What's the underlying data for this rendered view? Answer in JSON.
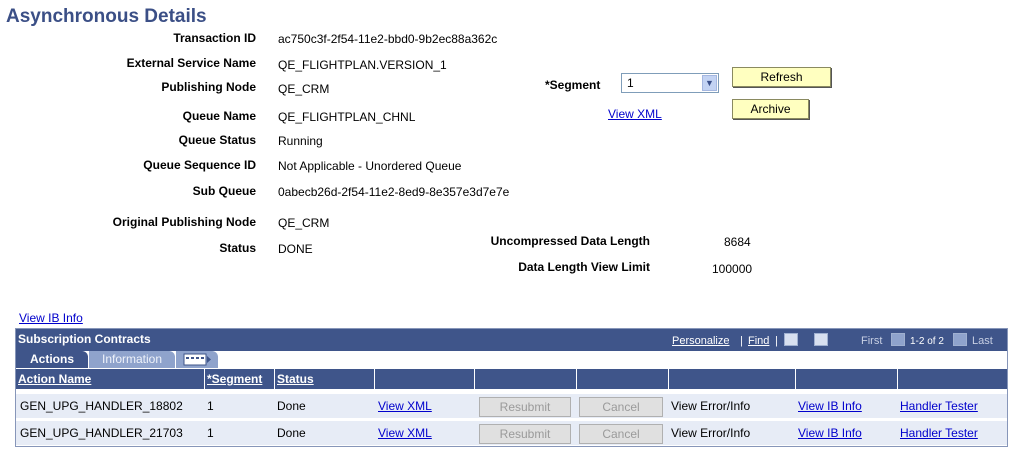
{
  "page_title": "Asynchronous Details",
  "fields": {
    "transaction_id": {
      "label": "Transaction ID",
      "value": "ac750c3f-2f54-11e2-bbd0-9b2ec88a362c"
    },
    "external_service_name": {
      "label": "External Service Name",
      "value": "QE_FLIGHTPLAN.VERSION_1"
    },
    "publishing_node": {
      "label": "Publishing Node",
      "value": "QE_CRM"
    },
    "queue_name": {
      "label": "Queue Name",
      "value": "QE_FLIGHTPLAN_CHNL"
    },
    "queue_status": {
      "label": "Queue Status",
      "value": "Running"
    },
    "queue_sequence_id": {
      "label": "Queue Sequence ID",
      "value": "Not Applicable - Unordered Queue"
    },
    "sub_queue": {
      "label": "Sub Queue",
      "value": "0abecb26d-2f54-11e2-8ed9-8e357e3d7e7e"
    },
    "original_publishing_node": {
      "label": "Original Publishing Node",
      "value": "QE_CRM"
    },
    "status": {
      "label": "Status",
      "value": "DONE"
    },
    "uncompressed_data_length": {
      "label": "Uncompressed Data Length",
      "value": "8684"
    },
    "data_length_view_limit": {
      "label": "Data Length View Limit",
      "value": "100000"
    }
  },
  "segment": {
    "label": "*Segment",
    "value": "1"
  },
  "buttons": {
    "refresh": "Refresh",
    "archive": "Archive"
  },
  "links": {
    "view_xml": "View XML",
    "view_ib_info": "View IB Info"
  },
  "grid": {
    "title": "Subscription Contracts",
    "nav": {
      "personalize": "Personalize",
      "sep1": "|",
      "find": "Find",
      "sep2": "|",
      "first": "First",
      "range": "1-2 of 2",
      "last": "Last"
    },
    "tabs": {
      "actions": "Actions",
      "information": "Information"
    },
    "columns": {
      "action_name": "Action Name",
      "segment": "*Segment",
      "status": "Status"
    },
    "rows": [
      {
        "action_name": "GEN_UPG_HANDLER_18802",
        "segment": "1",
        "status": "Done",
        "view_xml": "View XML",
        "resubmit": "Resubmit",
        "cancel": "Cancel",
        "view_error": "View Error/Info",
        "view_ib_info": "View IB Info",
        "handler_tester": "Handler Tester"
      },
      {
        "action_name": "GEN_UPG_HANDLER_21703",
        "segment": "1",
        "status": "Done",
        "view_xml": "View XML",
        "resubmit": "Resubmit",
        "cancel": "Cancel",
        "view_error": "View Error/Info",
        "view_ib_info": "View IB Info",
        "handler_tester": "Handler Tester"
      }
    ]
  },
  "colors": {
    "header_blue": "#3f558a",
    "title_blue": "#3b4f86",
    "button_yellow": "#ffffc0",
    "row_bg": "#e7ecf6",
    "link": "#0000cc"
  }
}
